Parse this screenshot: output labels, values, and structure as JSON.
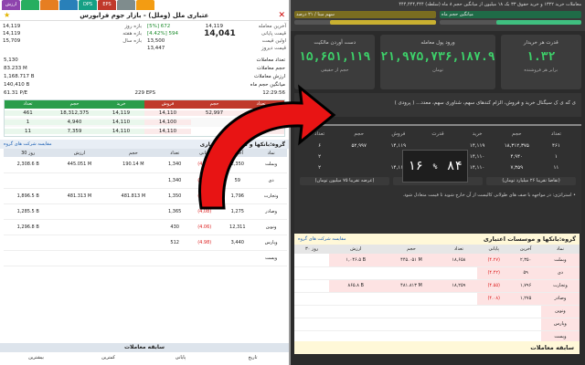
{
  "left": {
    "tabs": [
      {
        "label": "ارزش",
        "color": "#8e44ad"
      },
      {
        "label": "",
        "color": "#27ae60"
      },
      {
        "label": "",
        "color": "#e67e22"
      },
      {
        "label": "",
        "color": "#2980b9"
      },
      {
        "label": "DPS",
        "color": "#16a085"
      },
      {
        "label": "EPS",
        "color": "#c0392b"
      },
      {
        "label": "",
        "color": "#7f8c8d"
      },
      {
        "label": "",
        "color": "#f39c12"
      }
    ],
    "title": "عتباری ملل (وملل) - بازار جوم فرابورس",
    "close": "✕",
    "info_left": [
      {
        "l": "بازه روز",
        "v": "14,119"
      },
      {
        "l": "بازه هفته",
        "v": "14,119"
      },
      {
        "l": "بازه سال",
        "v": "15,709"
      }
    ],
    "info_mid": [
      {
        "l": "آخرین معامله",
        "v": "14,119",
        "note": "[5%] 672"
      },
      {
        "l": "قیمت پایانی",
        "v": "14,041",
        "note": "[4.42%] 594"
      },
      {
        "l": "اولین قیمت",
        "v": "13,500"
      },
      {
        "l": "قیمت دیروز",
        "v": "13,447"
      }
    ],
    "stats": [
      {
        "l": "تعداد معاملات",
        "v": "5,130"
      },
      {
        "l": "حجم معاملات",
        "v": "83.233 M"
      },
      {
        "l": "ارزش معاملات",
        "v": "1,168.717 B"
      },
      {
        "l": "میانگین حجم ماه",
        "v": "140,410 B"
      }
    ],
    "misc": {
      "pe": "61.31",
      "pe_l": "P/E",
      "eps": "229",
      "eps_l": "EPS",
      "time": "12:29:56"
    },
    "ob_headers": [
      "تعداد",
      "حجم",
      "خرید",
      "فروش",
      "حجم",
      "تعداد"
    ],
    "ob_rows": [
      [
        "461",
        "18,312,375",
        "14,119",
        "14,110",
        "52,997",
        "6"
      ],
      [
        "1",
        "4,940",
        "14,110",
        "14,100",
        "",
        "2"
      ],
      [
        "11",
        "7,359",
        "14,110",
        "14,110",
        "",
        "2"
      ]
    ],
    "group_title": "گروه:بانکها و موسسات اعتباری",
    "group_link": "مقایسه شرکت های گروه",
    "grp_headers": [
      "نماد",
      "آخرین",
      "پایانی",
      "تعداد",
      "حجم",
      "ارزش",
      "30 روز"
    ],
    "grp_rows": [
      [
        "وبملت",
        "2,350",
        "(4,27)",
        "1,340",
        "190.14 M",
        "445.051 M",
        "2,308.6 B"
      ],
      [
        "دی",
        "59",
        "(4.42)",
        "1,340",
        "",
        "",
        ""
      ],
      [
        "وتجارت",
        "1,796",
        "(4,55)",
        "1,350",
        "481.813 M",
        "481.313 M",
        "1,896.5 B"
      ],
      [
        "وصادر",
        "1,275",
        "(4,08)",
        "1,365",
        "",
        "",
        "1,285.5 B"
      ],
      [
        "ونوین",
        "12,311",
        "(4.06)",
        "430",
        "",
        "",
        "1,296.8 B"
      ],
      [
        "وپارس",
        "3,440",
        "(4.98)",
        "512",
        "",
        "",
        ""
      ],
      [
        "وپست",
        "",
        "",
        "",
        "",
        "",
        ""
      ]
    ],
    "history_title": "سابقه معاملات",
    "history_cols": [
      "تاریخ",
      "پایانی",
      "کمترین",
      "بیشترین"
    ]
  },
  "right": {
    "top_line": "معاملات خرید ۱۳۲۲ و خرید حقوق ۳۳ بک ۱۸ میلیون از میانگین حجم ۸ ماه (سلطه) ۴۴۴,۴۴۴,۴۴۴",
    "bars": [
      {
        "label": "میانگین حجم ماه",
        "pct": 0.6,
        "color": "#3fbf7f"
      },
      {
        "label": "سهم مبنا / ۲۱ درصد",
        "pct": 0.75,
        "color": "#c9b030"
      }
    ],
    "cards": [
      {
        "title": "قدرت هر خریدار",
        "value": "۱.۳۲",
        "sub": "برابر هر فروشنده"
      },
      {
        "title": "ورود پول معامله",
        "value": "۲۱,۹۷۵,۷۳۶,۱۸۷.۹",
        "sub": "تومان"
      },
      {
        "title": "دست آوردن مالکیت",
        "value": "۱۵,۶۵۱,۱۱۹",
        "sub": "حجم از حقیقی"
      }
    ],
    "note": "ی که ی ک سیگنال خرید و فروش، الزام کندهای سهم، شناوری سهم، معدد... ( پرودی )",
    "dob_headers": [
      "تعداد",
      "حجم",
      "خرید",
      "قدرت",
      "فروش",
      "حجم",
      "تعداد"
    ],
    "dob_rows": [
      [
        "۴۶۱",
        "۱۸,۳۱۲,۳۷۵",
        "۱۴,۱۱۹",
        "",
        "۱۴,۱۱۹",
        "۵۲,۹۹۷",
        "۶"
      ],
      [
        "۱",
        "۴,۹۴۰",
        "۱۴,۱۱۰",
        "",
        "",
        "",
        "۲"
      ],
      [
        "۱۱",
        "۷,۳۵۹",
        "۱۴,۱۱۰",
        "",
        "۱۴,۱۱۰",
        "",
        "۲"
      ]
    ],
    "power_buy": "۸۴",
    "power_sell": "۱۶",
    "power_sep": "%",
    "foot": [
      "(تقاضا تقریبا ۲۶ میلیارد تومان)",
      "خریدار در سقف قیمت",
      "(عرضه تقریبا ۷۵ میلیون تومان)"
    ],
    "dob_note": "• استراتژی: در مواجهه با صف های طولانی کالیست از آن خارج شوید تا قیمت متعادل شود.",
    "grp_title": "گروه:بانکها و موسسات اعتباری",
    "grp_link": "مقایسه شرکت های گروه",
    "grp_headers": [
      "نماد",
      "آخرین",
      "پایانی",
      "تعداد",
      "حجم",
      "ارزش",
      "۳۰ روز"
    ],
    "grp_rows": [
      [
        "وبملت",
        "۲,۳۵۰",
        "(۴.۲۷)",
        "۱۸,۶۵۸",
        "۴۴۵.۰۵۱ M",
        "۱,۰۴۶.۵ B",
        ""
      ],
      [
        "دی",
        "۵۹",
        "(۴.۴۲)",
        "",
        "",
        "",
        ""
      ],
      [
        "وتجارت",
        "۱,۷۹۶",
        "(۴.۵۵)",
        "۱۸,۲۵۹",
        "۴۸۱.۸۱۳ M",
        "۸۶۵.۸ B",
        ""
      ],
      [
        "وصادر",
        "۱,۲۷۵",
        "(۴.۰۸)",
        "",
        "",
        "",
        ""
      ],
      [
        "ونوین",
        "",
        "",
        "",
        "",
        "",
        ""
      ],
      [
        "وپارس",
        "",
        "",
        "",
        "",
        "",
        ""
      ],
      [
        "وپست",
        "",
        "",
        "",
        "",
        "",
        ""
      ]
    ],
    "history_title": "سابقه معاملات"
  }
}
